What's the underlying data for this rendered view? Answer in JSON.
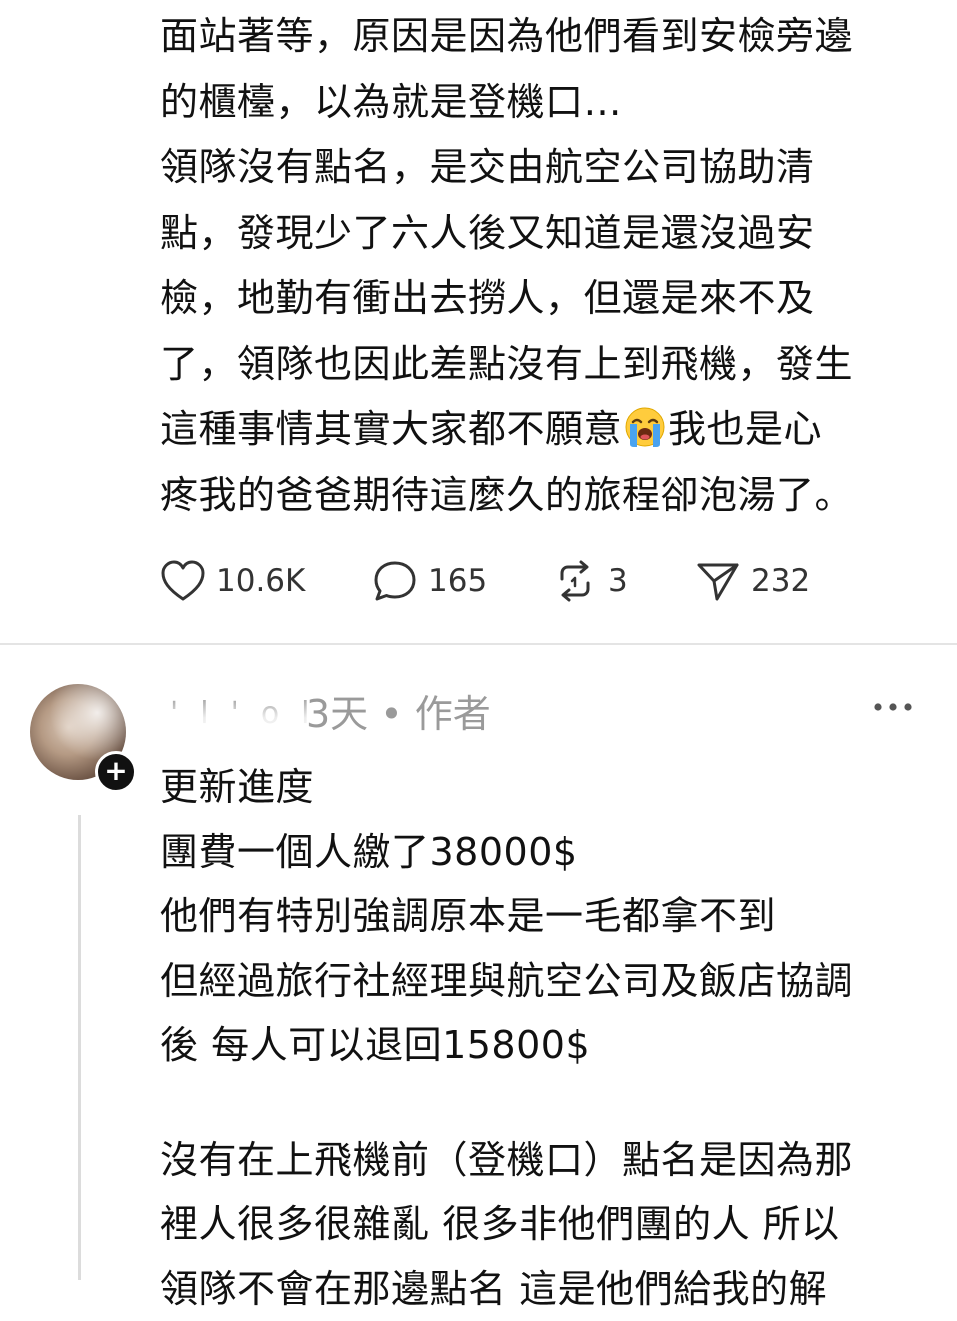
{
  "post": {
    "lines": [
      "面站著等，原因是因為他們看到安檢旁邊",
      "的櫃檯，以為就是登機口…",
      "領隊沒有點名，是交由航空公司協助清",
      "點，發現少了六人後又知道是還沒過安",
      "檢，地勤有衝出去撈人，但還是來不及",
      "了，領隊也因此差點沒有上到飛機，發生",
      "這種事情其實大家都不願意",
      "我也是心",
      "疼我的爸爸期待這麼久的旅程卻泡湯了。"
    ],
    "emoji_icon": "loudly-crying-face-emoji"
  },
  "actions": {
    "like_count": "10.6K",
    "comment_count": "165",
    "repost_count": "3",
    "share_count": "232"
  },
  "reply": {
    "meta": "3天 • 作者",
    "lines": [
      "更新進度",
      "團費一個人繳了38000$",
      "他們有特別強調原本是一毛都拿不到",
      "但經過旅行社經理與航空公司及飯店協調",
      "後 每人可以退回15800$",
      "",
      "沒有在上飛機前（登機口）點名是因為那",
      "裡人很多很雜亂 很多非他們團的人 所以",
      "領隊不會在那邊點名 這是他們給我的解"
    ]
  },
  "colors": {
    "text": "#111111",
    "meta": "#9a9a9a",
    "divider": "#e4e4e4",
    "thread_line": "#dcdcdc"
  }
}
